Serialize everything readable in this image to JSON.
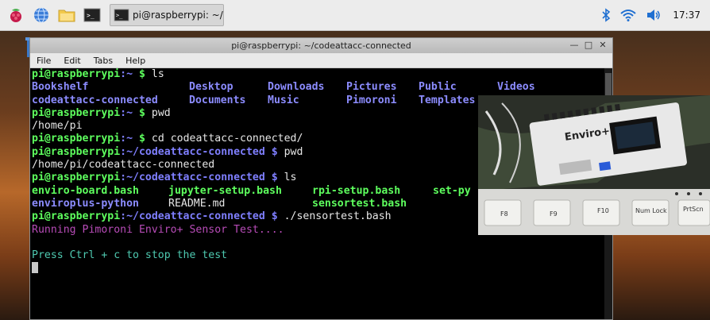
{
  "taskbar": {
    "task_title": "pi@raspberrypi: ~/co...",
    "clock": "17:37",
    "icons": [
      "raspberry-icon",
      "globe-icon",
      "folder-icon",
      "terminal-icon"
    ],
    "tray_icons": [
      "bluetooth-icon",
      "wifi-icon",
      "volume-icon"
    ]
  },
  "window": {
    "title": "pi@raspberrypi: ~/codeattacc-connected",
    "menu": [
      "File",
      "Edit",
      "Tabs",
      "Help"
    ]
  },
  "terminal": {
    "user_host": "pi@raspberrypi",
    "lines": [
      {
        "path": ":~ ",
        "cmd": "ls"
      },
      {
        "row": [
          "Bookshelf",
          "Desktop",
          "Downloads",
          "Pictures",
          "Public",
          "Videos"
        ]
      },
      {
        "row": [
          "codeattacc-connected",
          "Documents",
          "Music",
          "Pimoroni",
          "Templates"
        ]
      },
      {
        "path": ":~ ",
        "cmd": "pwd"
      },
      {
        "out": "/home/pi"
      },
      {
        "path": ":~ ",
        "cmd": "cd codeattacc-connected/"
      },
      {
        "path": ":~/codeattacc-connected ",
        "cmd": "pwd"
      },
      {
        "out": "/home/pi/codeattacc-connected"
      },
      {
        "path": ":~/codeattacc-connected ",
        "cmd": "ls"
      }
    ],
    "ls2": [
      "enviro-board.bash",
      "jupyter-setup.bash",
      "rpi-setup.bash",
      "set-py"
    ],
    "ls3_a": "enviroplus-python",
    "ls3_b": "README.md",
    "ls3_c": "sensortest.bash",
    "last_path": ":~/codeattacc-connected ",
    "last_cmd": "./sensortest.bash",
    "running": "Running Pimoroni Enviro+ Sensor Test....",
    "stop_msg": "Press Ctrl + c to stop the test"
  },
  "camera": {
    "board_label": "Enviro+",
    "keys": [
      "F8",
      "F9",
      "F10",
      "Num Lock",
      "PrtScn"
    ]
  }
}
